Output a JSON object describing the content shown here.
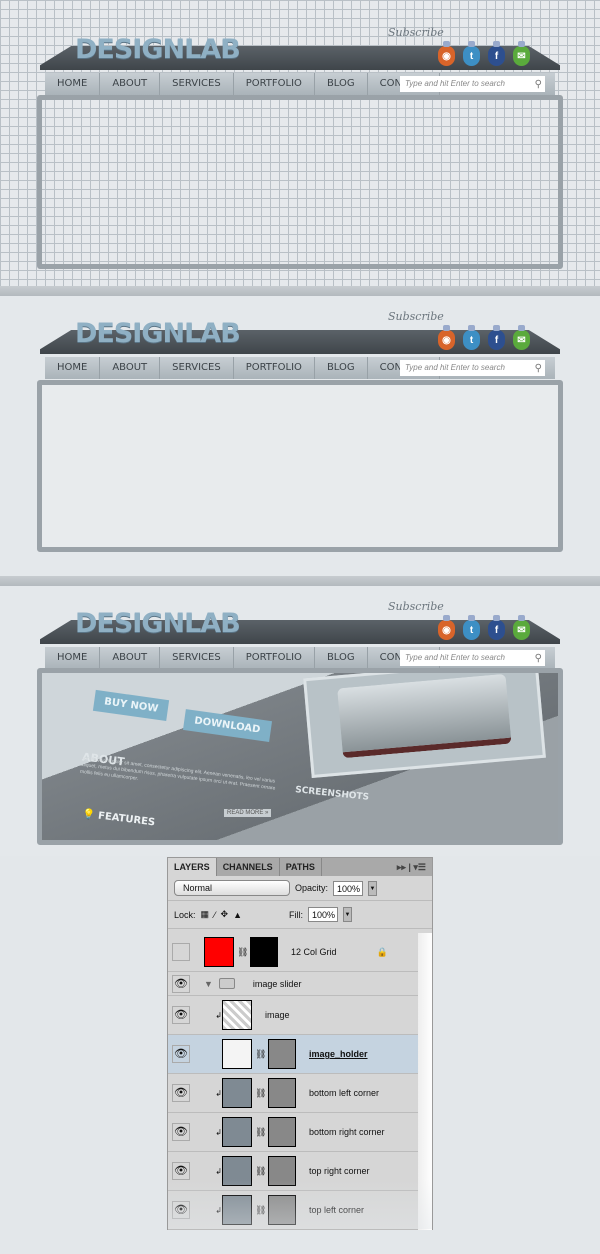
{
  "site": {
    "logo": "DESIGNLAB",
    "subscribe": "Subscribe",
    "social": [
      {
        "icon": "rss-icon",
        "glyph": "◉",
        "color": "#d8642a"
      },
      {
        "icon": "twitter-icon",
        "glyph": "t",
        "color": "#3d8fc4"
      },
      {
        "icon": "facebook-icon",
        "glyph": "f",
        "color": "#2d4f8f"
      },
      {
        "icon": "email-icon",
        "glyph": "✉",
        "color": "#5aaa3c"
      }
    ],
    "nav": [
      "HOME",
      "ABOUT",
      "SERVICES",
      "PORTFOLIO",
      "BLOG",
      "CONTACT"
    ],
    "search_placeholder": "Type and hit Enter to search"
  },
  "slider": {
    "buy_now": "BUY NOW",
    "download": "DOWNLOAD",
    "about": "ABOUT",
    "about_text": "Lorem ipsum dolor sit amet, consectetur adipiscing elit. Aenean venenatis, leo vel varius aliquet, metus dui bibendum risus, pharetra vulputate ipsum orci ut erat. Praesent ornare mollis felis eu ullamcorper.",
    "read_more": "READ MORE »",
    "screenshots": "SCREENSHOTS",
    "features": "FEATURES"
  },
  "panel": {
    "tabs": [
      "LAYERS",
      "CHANNELS",
      "PATHS"
    ],
    "blend_mode": "Normal",
    "opacity_label": "Opacity:",
    "opacity": "100%",
    "lock_label": "Lock:",
    "fill_label": "Fill:",
    "fill": "100%",
    "layers": [
      {
        "name": "12 Col Grid",
        "visible": false,
        "locked": true
      },
      {
        "name": "image slider",
        "group": true,
        "visible": true
      },
      {
        "name": "image",
        "visible": true
      },
      {
        "name": "image_holder",
        "visible": true,
        "selected": true
      },
      {
        "name": "bottom left corner",
        "visible": true
      },
      {
        "name": "bottom right corner",
        "visible": true
      },
      {
        "name": "top right corner",
        "visible": true
      },
      {
        "name": "top left corner",
        "visible": true
      }
    ]
  }
}
